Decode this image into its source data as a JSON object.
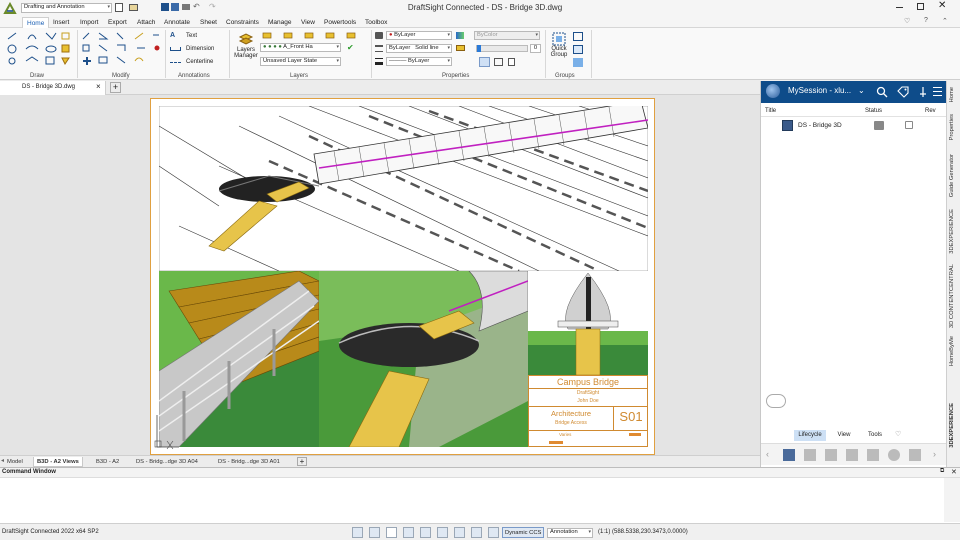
{
  "app": {
    "window_title": "DraftSight Connected - DS - Bridge 3D.dwg",
    "workspace": "Drafting and Annotation"
  },
  "menu_tabs": [
    "Home",
    "Insert",
    "Import",
    "Export",
    "Attach",
    "Annotate",
    "Sheet",
    "Constraints",
    "Manage",
    "View",
    "Powertools",
    "Toolbox"
  ],
  "ribbon": {
    "groups": {
      "draw": "Draw",
      "modify": "Modify",
      "annotations": "Annotations",
      "layers": "Layers",
      "properties": "Properties",
      "groups": "Groups"
    },
    "annotations": {
      "text": "Text",
      "dimension": "Dimension",
      "centerline": "Centerline"
    },
    "layers": {
      "manager_line1": "Layers",
      "manager_line2": "Manager",
      "current_layer": "A_Front Ha",
      "layer_state": "Unsaved Layer State"
    },
    "properties": {
      "color": "ByLayer",
      "linetype": "ByLayer",
      "linetype_style": "Solid line",
      "lineweight": "ByLayer",
      "plot_color": "ByColor",
      "transparency": "0"
    },
    "quick_group": {
      "line1": "Quick",
      "line2": "Group"
    }
  },
  "doc_tab": "DS - Bridge 3D.dwg",
  "sheet": {
    "title_block": {
      "project": "Campus Bridge",
      "client": "DraftSight",
      "author": "John Doe",
      "discipline": "Architecture",
      "drawing_name": "Bridge Access",
      "sheet_number": "S01",
      "scale": "Varies"
    }
  },
  "layout_tabs": [
    "Model",
    "B3D - A2 Views",
    "B3D - A2",
    "DS - Bridg...dge 3D A04",
    "DS - Bridg...dge 3D A01"
  ],
  "active_layout": "B3D - A2 Views",
  "command_window": {
    "title": "Command Window"
  },
  "status": {
    "product": "DraftSight Connected 2022  x64 SP2",
    "dynamic_ccs": "Dynamic CCS",
    "annotation": "Annotation",
    "scale": "(1:1)",
    "coordinates": "(588.5338,230.3473,0.0000)"
  },
  "panel": {
    "session": "MySession - xlu...",
    "columns": {
      "title": "Title",
      "status": "Status",
      "rev": "Rev"
    },
    "rows": [
      {
        "title": "DS - Bridge 3D"
      }
    ],
    "bottom_tabs": [
      "Lifecycle",
      "View",
      "Tools"
    ],
    "side_tabs": [
      "Home",
      "Properties",
      "Guide Generator",
      "3DEXPERIENCE",
      "3D CONTENTCENTRAL",
      "HomeByMe",
      "3DEXPERIENCE"
    ],
    "accent": "#0e4c8a",
    "bottom_tab_active_bg": "#cde0f5"
  }
}
